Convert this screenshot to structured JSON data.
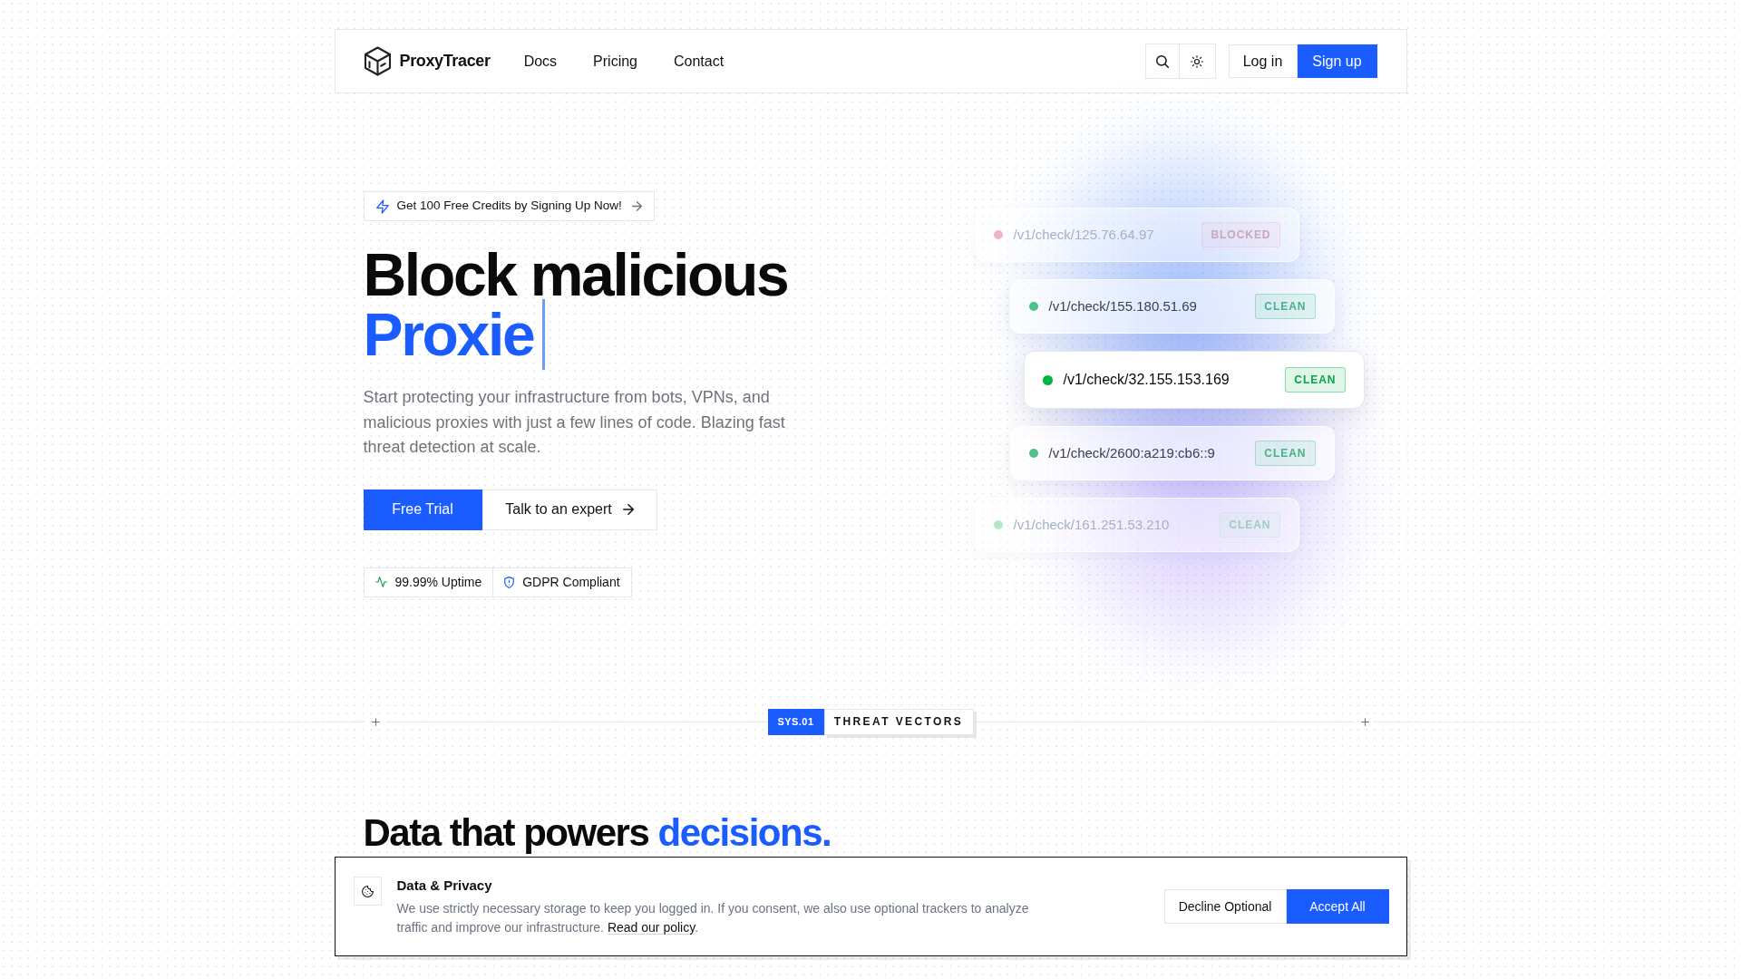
{
  "nav": {
    "brand": "ProxyTracer",
    "links": [
      {
        "label": "Docs"
      },
      {
        "label": "Pricing"
      },
      {
        "label": "Contact"
      }
    ],
    "login": "Log in",
    "signup": "Sign up"
  },
  "hero": {
    "promo": "Get 100 Free Credits by Signing Up Now!",
    "heading": "Block malicious",
    "heading_accent": "Proxie",
    "description": "Start protecting your infrastructure from bots, VPNs, and malicious proxies with just a few lines of code. Blazing fast threat detection at scale.",
    "buttons": [
      {
        "label": "Free Trial",
        "kind": "primary"
      },
      {
        "label": "Talk to an expert",
        "kind": "secondary"
      }
    ],
    "stats": [
      {
        "label": "99.99% Uptime",
        "kind": "uptime"
      },
      {
        "label": "GDPR Compliant",
        "kind": "compliance"
      }
    ]
  },
  "checks": [
    {
      "path": "/v1/check/125.76.64.97",
      "status": "BLOCKED",
      "color": "#f0b4c8",
      "kind": "faded"
    },
    {
      "path": "/v1/check/155.180.51.69",
      "status": "CLEAN",
      "color": "#4cc38a",
      "kind": "dimmed"
    },
    {
      "path": "/v1/check/32.155.153.169",
      "status": "CLEAN",
      "color": "#00b341",
      "kind": "active"
    },
    {
      "path": "/v1/check/2600:a219:cb6::9",
      "status": "CLEAN",
      "color": "#4cc38a",
      "kind": "dimmed"
    },
    {
      "path": "/v1/check/161.251.53.210",
      "status": "CLEAN",
      "color": "#b5e6cc",
      "kind": "faded"
    }
  ],
  "section": {
    "tag": "SYS.01",
    "label": "THREAT VECTORS",
    "heading": "Data that powers",
    "heading_accent": "decisions."
  },
  "cookie_banner": {
    "title": "Data & Privacy",
    "text": "We use strictly necessary storage to keep you logged in. If you consent, we also use optional trackers to analyze traffic and improve our infrastructure.",
    "link": "Read our policy",
    "text_end": ".",
    "buttons": [
      {
        "label": "Decline Optional",
        "kind": "secondary"
      },
      {
        "label": "Accept All",
        "kind": "primary"
      }
    ]
  }
}
